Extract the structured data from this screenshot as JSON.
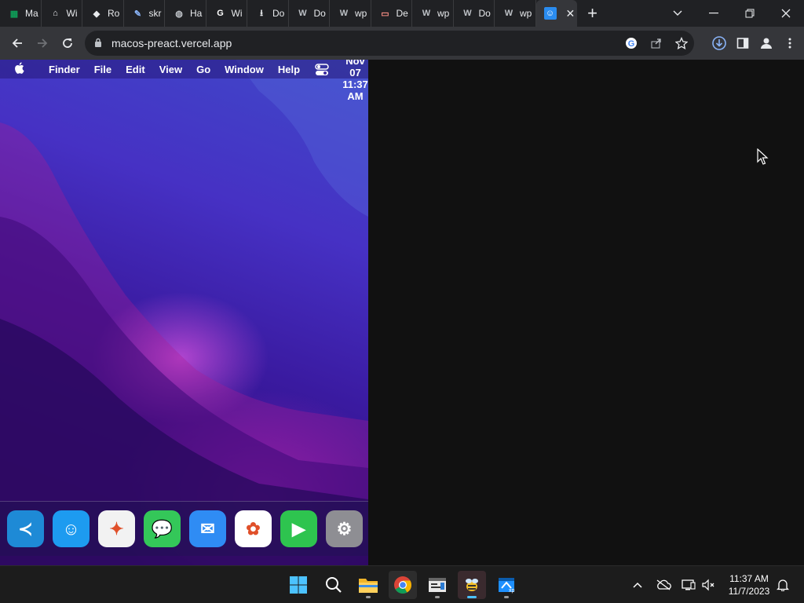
{
  "browser": {
    "tabs": [
      {
        "label": "Ma",
        "icon": "sheets-icon",
        "color": "#0f9d58"
      },
      {
        "label": "Wi",
        "icon": "museum-icon",
        "color": "#e8eaed"
      },
      {
        "label": "Ro",
        "icon": "roblox-icon",
        "color": "#e8eaed"
      },
      {
        "label": "skr",
        "icon": "feather-icon",
        "color": "#8ab4f8"
      },
      {
        "label": "Ha",
        "icon": "globe-icon",
        "color": "#bdc1c6"
      },
      {
        "label": "Wi",
        "icon": "google-icon",
        "color": "#ffffff"
      },
      {
        "label": "Do",
        "icon": "download-icon",
        "color": "#e8eaed"
      },
      {
        "label": "Do",
        "icon": "w-icon",
        "color": "#bdc1c6"
      },
      {
        "label": "wp",
        "icon": "w-icon",
        "color": "#bdc1c6"
      },
      {
        "label": "De",
        "icon": "monitor-icon",
        "color": "#f28b82"
      },
      {
        "label": "wp",
        "icon": "w-icon",
        "color": "#bdc1c6"
      },
      {
        "label": "Do",
        "icon": "w-icon",
        "color": "#bdc1c6"
      },
      {
        "label": "wp",
        "icon": "w-icon",
        "color": "#bdc1c6"
      }
    ],
    "active_tab": {
      "icon": "finder-icon",
      "close": "✕"
    },
    "new_tab": "+",
    "url": "macos-preact.vercel.app"
  },
  "mac": {
    "menu": [
      "Finder",
      "File",
      "Edit",
      "View",
      "Go",
      "Window",
      "Help"
    ],
    "clock_lines": [
      "Nov",
      "07",
      "11:37",
      "AM"
    ],
    "dock_apps": [
      {
        "name": "vscode-icon",
        "bg": "#1e8ad6",
        "glyph": "≺"
      },
      {
        "name": "finder-icon",
        "bg": "#1d9bf0",
        "glyph": "☺"
      },
      {
        "name": "safari-icon",
        "bg": "#f2f2f2",
        "glyph": "✦"
      },
      {
        "name": "messages-icon",
        "bg": "#34c759",
        "glyph": "💬"
      },
      {
        "name": "mail-icon",
        "bg": "#2f8cf4",
        "glyph": "✉"
      },
      {
        "name": "photos-icon",
        "bg": "#ffffff",
        "glyph": "✿"
      },
      {
        "name": "facetime-icon",
        "bg": "#2ec44f",
        "glyph": "▶"
      },
      {
        "name": "system-preferences-icon",
        "bg": "#8e8e93",
        "glyph": "⚙"
      }
    ]
  },
  "taskbar": {
    "time": "11:37 AM",
    "date": "11/7/2023"
  }
}
